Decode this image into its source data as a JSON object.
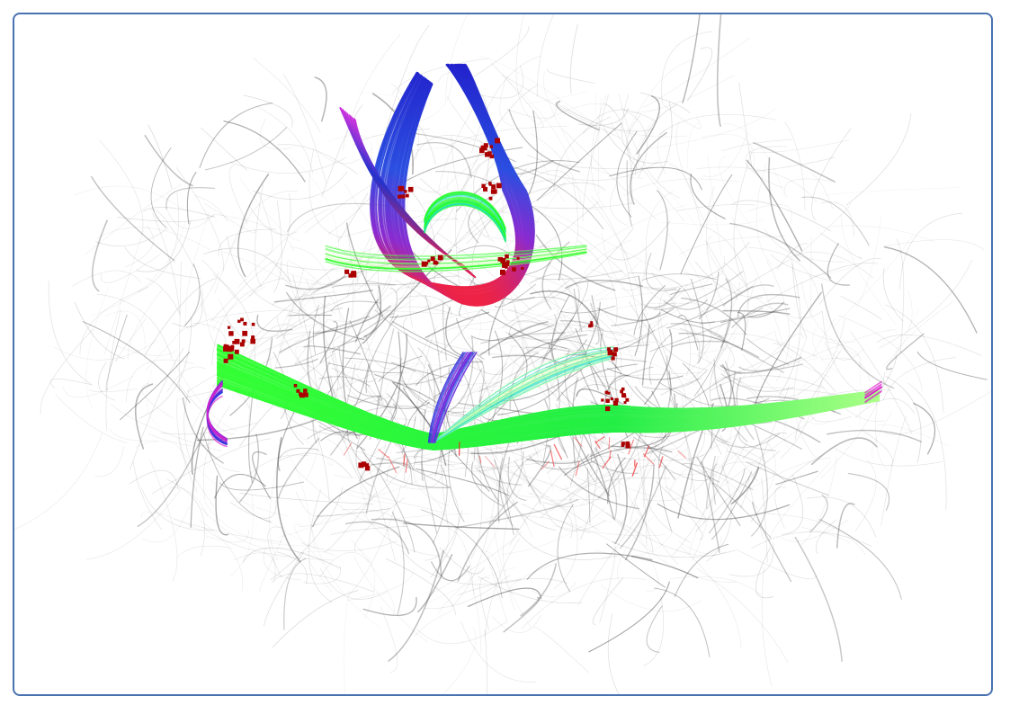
{
  "viewer": {
    "frame_color": "#4a72b0",
    "background_color": "#ffffff"
  },
  "scene": {
    "subject": "brain-tractography",
    "background_fibers_color": "#3a3a3a",
    "tract_colors": {
      "green": "#22ff22",
      "blue": "#2233dd",
      "magenta": "#dd22cc",
      "red": "#ee2222",
      "cyan": "#22ddcc",
      "pale_green": "#ccffaa"
    },
    "roi_marker_color": "#aa0000"
  }
}
